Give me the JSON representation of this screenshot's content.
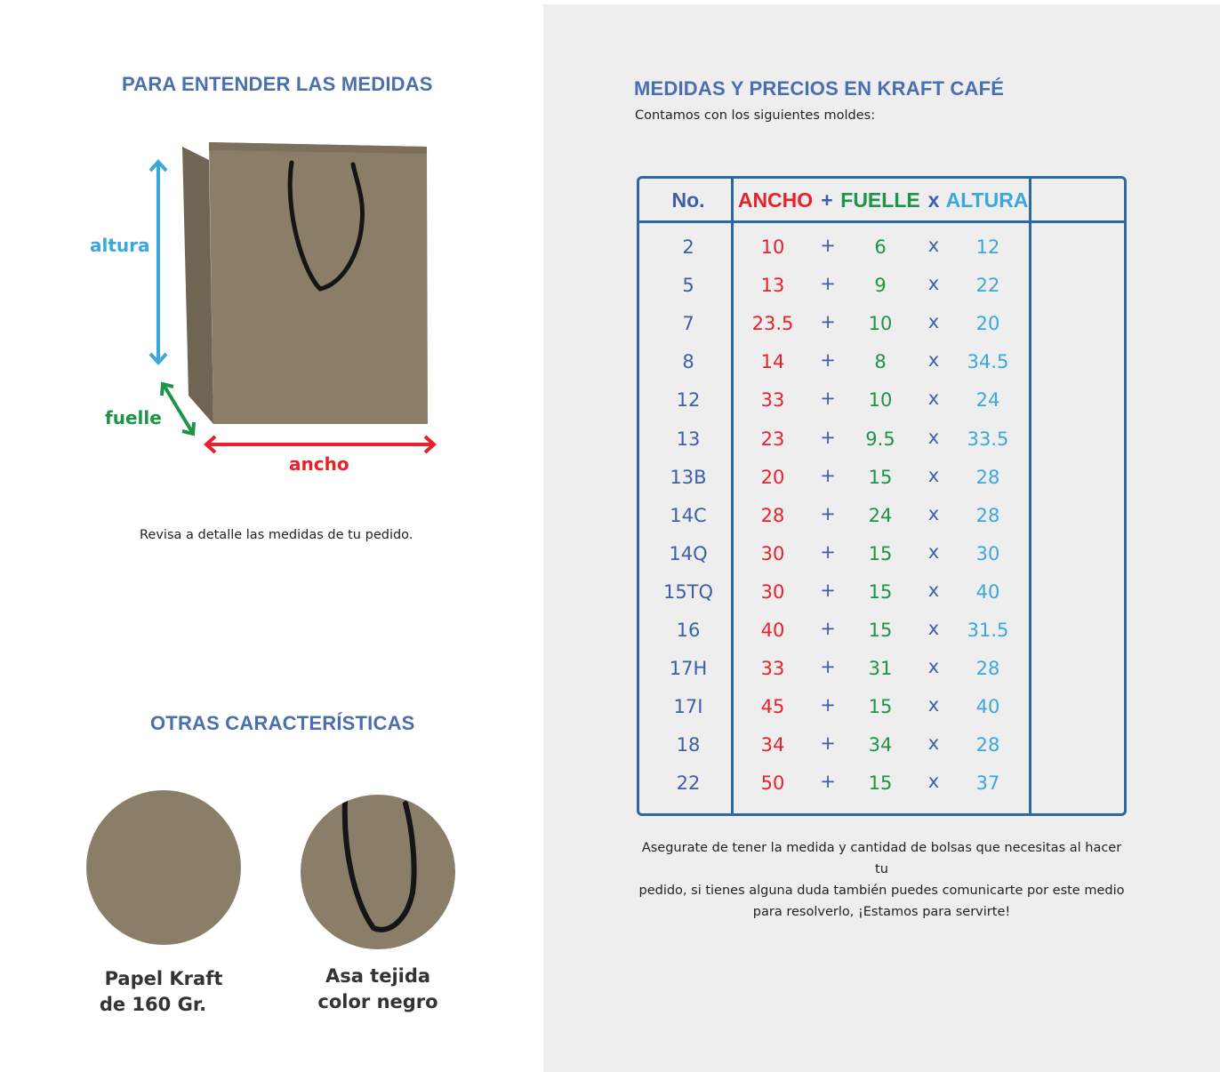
{
  "left": {
    "title1": "PARA ENTENDER LAS MEDIDAS",
    "labels": {
      "altura": "altura",
      "fuelle": "fuelle",
      "ancho": "ancho"
    },
    "caption": "Revisa a detalle las medidas de tu pedido.",
    "title2": "OTRAS CARACTERÍSTICAS",
    "features": [
      {
        "line1": "Papel Kraft",
        "line2": "de 160 Gr."
      },
      {
        "line1": "Asa tejida",
        "line2": "color negro"
      }
    ]
  },
  "right": {
    "title": "MEDIDAS Y PRECIOS EN KRAFT CAFÉ",
    "subtitle": "Contamos con los siguientes moldes:",
    "table": {
      "headers": {
        "no": "No.",
        "ancho": "ANCHO",
        "plus": "+",
        "fuelle": "FUELLE",
        "x": "x",
        "altura": "ALTURA"
      },
      "rows": [
        {
          "no": "2",
          "ancho": "10",
          "op1": "+",
          "fuelle": "6",
          "op2": "x",
          "altura": "12"
        },
        {
          "no": "5",
          "ancho": "13",
          "op1": "+",
          "fuelle": "9",
          "op2": "x",
          "altura": "22"
        },
        {
          "no": "7",
          "ancho": "23.5",
          "op1": "+",
          "fuelle": "10",
          "op2": "x",
          "altura": "20"
        },
        {
          "no": "8",
          "ancho": "14",
          "op1": "+",
          "fuelle": "8",
          "op2": "x",
          "altura": "34.5"
        },
        {
          "no": "12",
          "ancho": "33",
          "op1": "+",
          "fuelle": "10",
          "op2": "x",
          "altura": "24"
        },
        {
          "no": "13",
          "ancho": "23",
          "op1": "+",
          "fuelle": "9.5",
          "op2": "x",
          "altura": "33.5"
        },
        {
          "no": "13B",
          "ancho": "20",
          "op1": "+",
          "fuelle": "15",
          "op2": "x",
          "altura": "28"
        },
        {
          "no": "14C",
          "ancho": "28",
          "op1": "+",
          "fuelle": "24",
          "op2": "x",
          "altura": "28"
        },
        {
          "no": "14Q",
          "ancho": "30",
          "op1": "+",
          "fuelle": "15",
          "op2": "x",
          "altura": "30"
        },
        {
          "no": "15TQ",
          "ancho": "30",
          "op1": "+",
          "fuelle": "15",
          "op2": "x",
          "altura": "40"
        },
        {
          "no": "16",
          "ancho": "40",
          "op1": "+",
          "fuelle": "15",
          "op2": "x",
          "altura": "31.5"
        },
        {
          "no": "17H",
          "ancho": "33",
          "op1": "+",
          "fuelle": "31",
          "op2": "x",
          "altura": "28"
        },
        {
          "no": "17I",
          "ancho": "45",
          "op1": "+",
          "fuelle": "15",
          "op2": "x",
          "altura": "40"
        },
        {
          "no": "18",
          "ancho": "34",
          "op1": "+",
          "fuelle": "34",
          "op2": "x",
          "altura": "28"
        },
        {
          "no": "22",
          "ancho": "50",
          "op1": "+",
          "fuelle": "15",
          "op2": "x",
          "altura": "37"
        }
      ]
    },
    "note": [
      "Asegurate de tener la medida y cantidad de bolsas que necesitas al hacer tu",
      "pedido, si tienes alguna duda también puedes comunicarte por este medio",
      "para resolverlo, ¡Estamos para servirte!"
    ]
  },
  "colors": {
    "title_blue": "#4a6fb0",
    "ancho_red": "#e8222c",
    "fuelle_green": "#1e9448",
    "altura_sky": "#3ba7dd",
    "table_border": "#2d67a6",
    "kraft": "#8a7e68"
  }
}
